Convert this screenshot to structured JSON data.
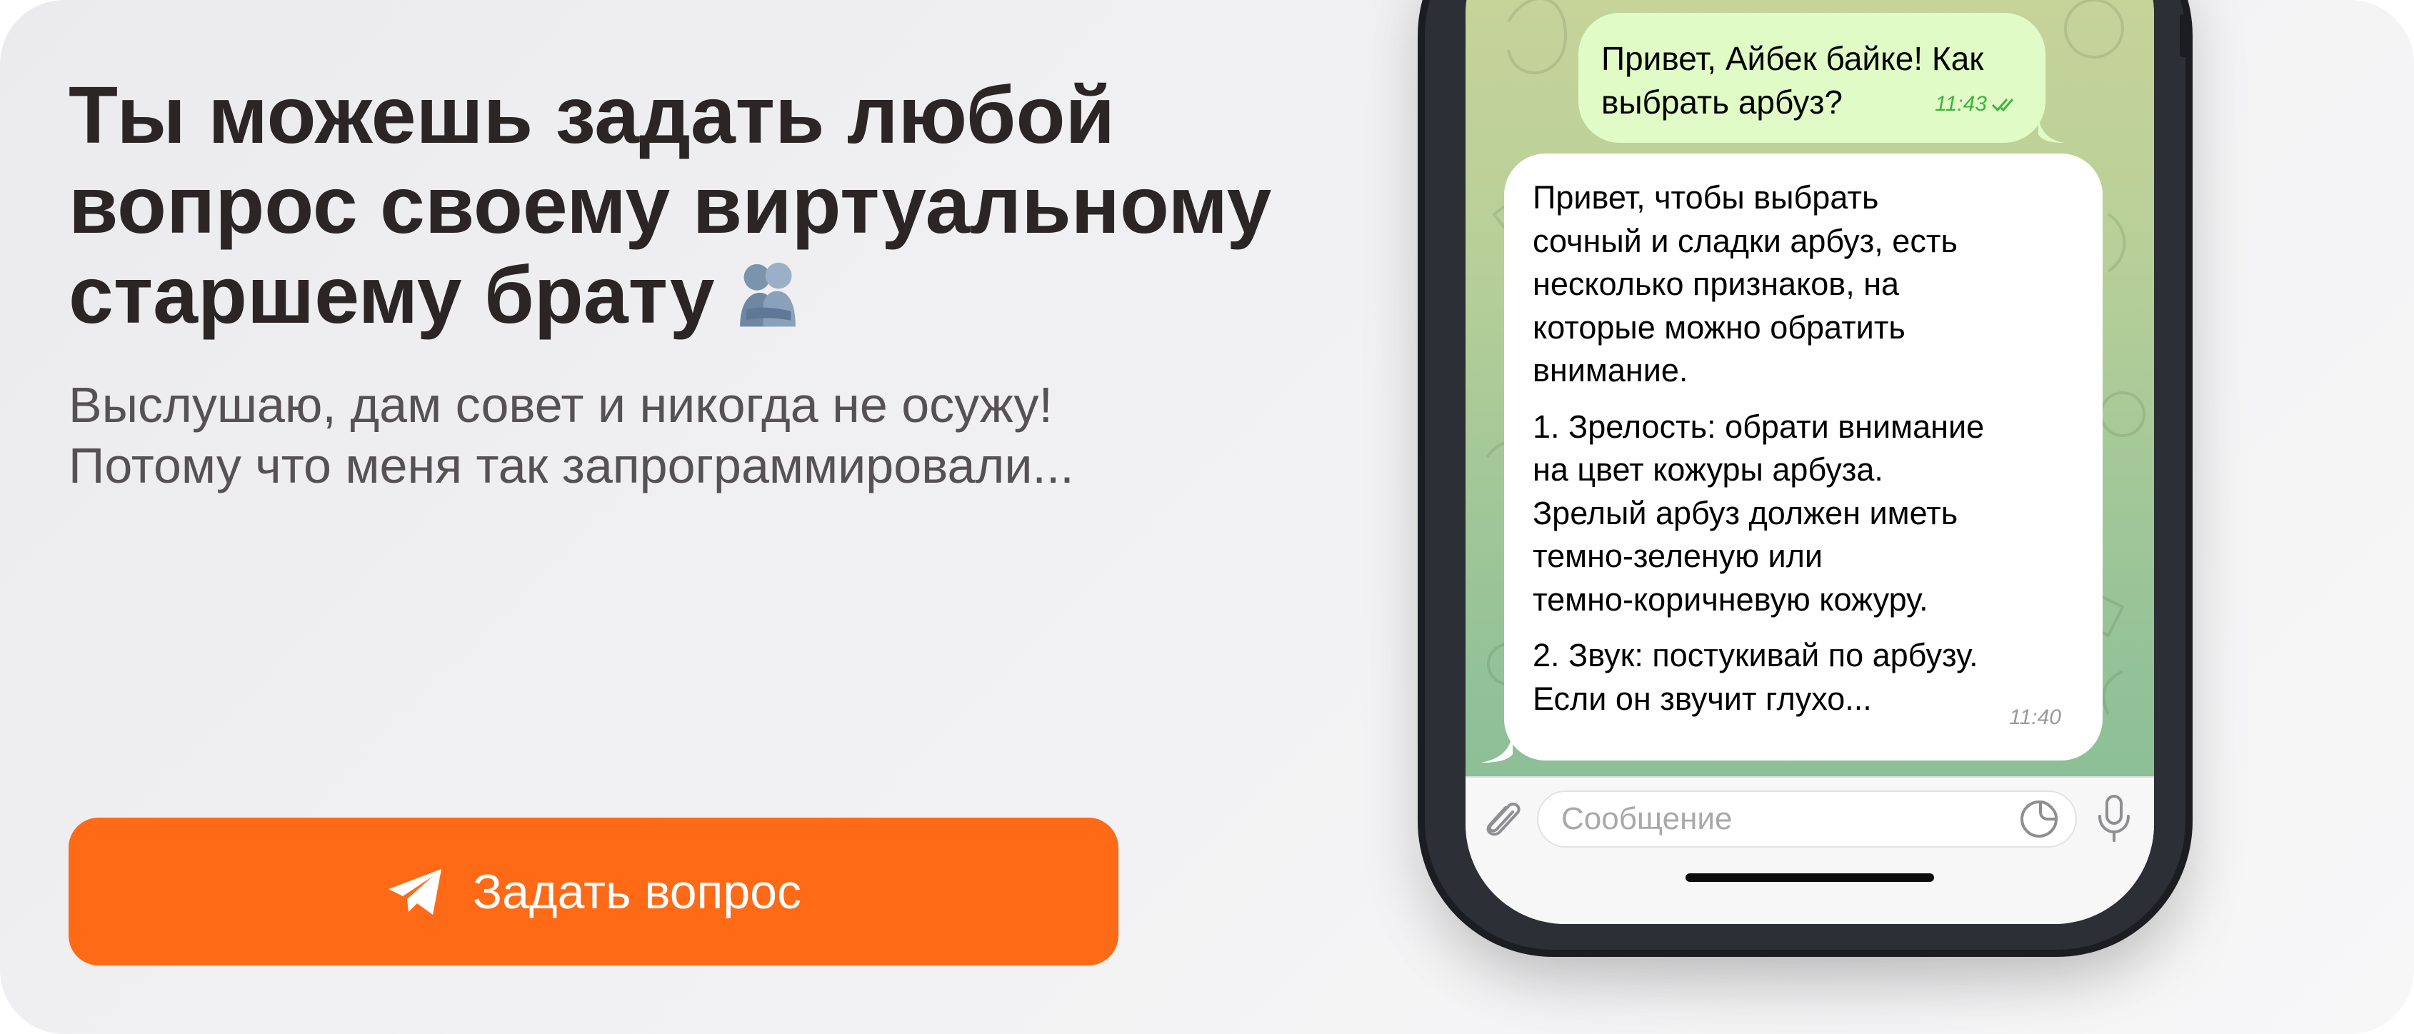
{
  "promo": {
    "title_lines": [
      "Ты можешь задать любой",
      "вопрос своему виртуальному",
      "старшему брату"
    ],
    "subtitle_lines": [
      "Выслушаю, дам совет и никогда не осужу!",
      "Потому что меня так запрограммировали..."
    ],
    "cta_label": "Задать вопрос",
    "title_emoji_icon": "people-hugging-icon",
    "cta_icon": "telegram-plane-icon"
  },
  "chat": {
    "outgoing": {
      "lines": [
        "Привет, Айбек байке! Как",
        "выбрать арбуз?"
      ],
      "time": "11:43",
      "status_icon": "double-check-icon"
    },
    "incoming": {
      "paragraphs": [
        [
          "Привет, чтобы выбрать",
          "сочный и сладки арбуз, есть",
          "несколько признаков, на",
          "которые можно обратить",
          "внимание."
        ],
        [
          "1. Зрелость: обрати внимание",
          "на цвет кожуры арбуза.",
          "Зрелый арбуз должен иметь",
          "темно-зеленую или",
          "темно-коричневую кожуру."
        ],
        [
          "2. Звук: постукивай по арбузу.",
          "Если он звучит глухо..."
        ]
      ],
      "time": "11:40"
    },
    "composer": {
      "placeholder": "Сообщение",
      "attach_icon": "paperclip-icon",
      "sticker_icon": "sticker-icon",
      "mic_icon": "microphone-icon"
    }
  },
  "colors": {
    "cta": "#ff6a16",
    "title": "#2b2526",
    "subtitle": "#565254",
    "outgoing_bubble": "#e0fbc5",
    "outgoing_time": "#3fb23c",
    "chat_bg_top": "#cbd59a",
    "chat_bg_bottom": "#8dbf97"
  }
}
